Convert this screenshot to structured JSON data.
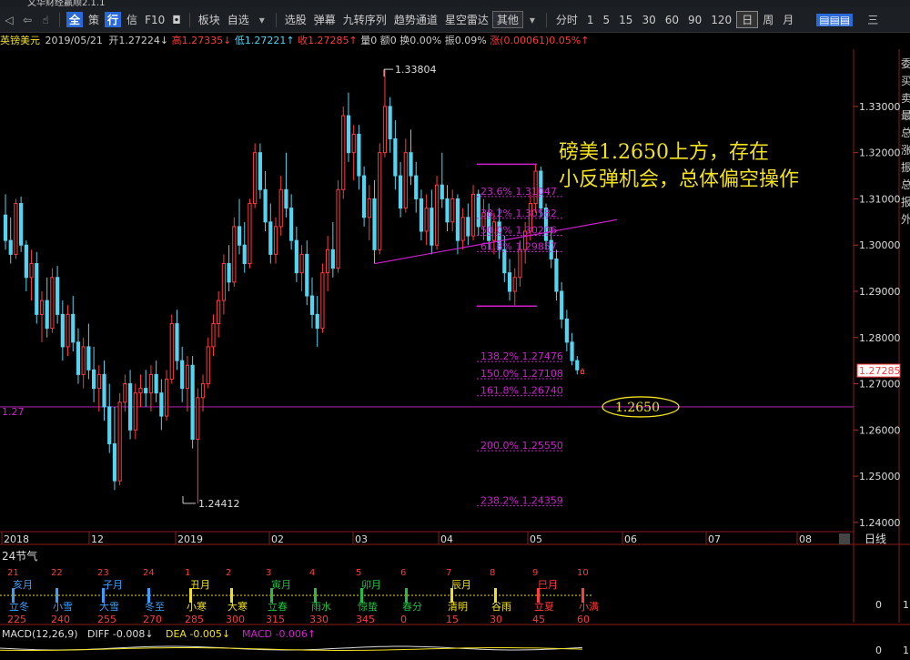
{
  "app": {
    "title": "文华财经赢顺2.1.1"
  },
  "toolbar": {
    "nav_icons": [
      "◁",
      "⇦",
      "☝"
    ],
    "items": [
      "全",
      "策",
      "行",
      "信",
      "F10",
      "◘",
      "板块",
      "自选",
      "选股",
      "弹幕",
      "九转序列",
      "趋势通道",
      "星空雷达",
      "其他",
      "分时",
      "1",
      "5",
      "15",
      "30",
      "60",
      "90",
      "120",
      "日",
      "周",
      "月"
    ],
    "dropdown_arrow": "▾",
    "right_button": "▤▤▤",
    "right_text": "三"
  },
  "info": {
    "symbol": "英镑美元",
    "date": "2019/05/21",
    "open_label": "开",
    "open": "1.27224↓",
    "high_label": "高",
    "high": "1.27335↓",
    "low_label": "低",
    "low": "1.27221↑",
    "close_label": "收",
    "close": "1.27285↑",
    "vol_label": "量",
    "vol": "0",
    "amt_label": "额",
    "amt": "0",
    "turnover_label": "换",
    "turnover": "0.00%",
    "amp_label": "振",
    "amp": "0.09%",
    "chg_label": "涨",
    "chg": "(0.00061)0.05%↑"
  },
  "colors": {
    "up": "#ff3b3b",
    "down": "#54d4f0",
    "fib": "#d020d0",
    "hline": "#a020a0",
    "annot": "#f0e020",
    "bg": "#000000"
  },
  "chart_data": {
    "type": "candlestick",
    "title": "",
    "ylim": [
      1.238,
      1.342
    ],
    "y_ticks": [
      1.24,
      1.25,
      1.26,
      1.27,
      1.28,
      1.29,
      1.3,
      1.31,
      1.32,
      1.33
    ],
    "y_tick_labels": [
      "1.24000",
      "1.25000",
      "1.26000",
      "1.27000",
      "1.28000",
      "1.29000",
      "1.30000",
      "1.31000",
      "1.32000",
      "1.33000"
    ],
    "x_labels": [
      "2018",
      "12",
      "2019",
      "02",
      "03",
      "04",
      "05",
      "06",
      "07",
      "08"
    ],
    "current_price": "1.27285",
    "high_marker": "1.33804",
    "low_marker": "1.24412",
    "horizontal_line": {
      "value": 1.265,
      "label": "1.27"
    },
    "fib_levels": [
      {
        "ratio": "23.6%",
        "value": "1.31047",
        "price": 1.3105
      },
      {
        "ratio": "38.2%",
        "value": "1.30582",
        "price": 1.3058
      },
      {
        "ratio": "50.0%",
        "value": "1.30206",
        "price": 1.3021
      },
      {
        "ratio": "61.8%",
        "value": "1.29857",
        "price": 1.2986
      },
      {
        "ratio": "138.2%",
        "value": "1.27476",
        "price": 1.2748
      },
      {
        "ratio": "150.0%",
        "value": "1.27108",
        "price": 1.2711
      },
      {
        "ratio": "161.8%",
        "value": "1.26740",
        "price": 1.2674
      },
      {
        "ratio": "200.0%",
        "value": "1.25550",
        "price": 1.2555
      },
      {
        "ratio": "238.2%",
        "value": "1.24359",
        "price": 1.2436
      }
    ],
    "annotation": "磅美1.2650上方，存在小反弹机会，总体偏空操作",
    "target_label": "1.2650",
    "period_label": "日线",
    "candles": [
      [
        1.3065,
        1.311,
        1.299,
        1.301
      ],
      [
        1.301,
        1.306,
        1.296,
        1.298
      ],
      [
        1.298,
        1.31,
        1.297,
        1.309
      ],
      [
        1.309,
        1.3105,
        1.2985,
        1.3
      ],
      [
        1.3,
        1.301,
        1.29,
        1.293
      ],
      [
        1.293,
        1.299,
        1.288,
        1.296
      ],
      [
        1.296,
        1.2985,
        1.283,
        1.285
      ],
      [
        1.285,
        1.29,
        1.279,
        1.288
      ],
      [
        1.288,
        1.293,
        1.28,
        1.282
      ],
      [
        1.282,
        1.295,
        1.281,
        1.293
      ],
      [
        1.293,
        1.2955,
        1.283,
        1.285
      ],
      [
        1.285,
        1.288,
        1.275,
        1.278
      ],
      [
        1.278,
        1.287,
        1.276,
        1.285
      ],
      [
        1.285,
        1.289,
        1.277,
        1.279
      ],
      [
        1.279,
        1.282,
        1.27,
        1.272
      ],
      [
        1.272,
        1.28,
        1.269,
        1.278
      ],
      [
        1.278,
        1.283,
        1.271,
        1.273
      ],
      [
        1.273,
        1.278,
        1.266,
        1.269
      ],
      [
        1.269,
        1.274,
        1.264,
        1.272
      ],
      [
        1.272,
        1.275,
        1.262,
        1.265
      ],
      [
        1.265,
        1.27,
        1.255,
        1.257
      ],
      [
        1.257,
        1.265,
        1.247,
        1.249
      ],
      [
        1.249,
        1.268,
        1.248,
        1.266
      ],
      [
        1.266,
        1.272,
        1.264,
        1.27
      ],
      [
        1.27,
        1.273,
        1.258,
        1.26
      ],
      [
        1.26,
        1.27,
        1.258,
        1.268
      ],
      [
        1.268,
        1.272,
        1.265,
        1.269
      ],
      [
        1.269,
        1.273,
        1.265,
        1.268
      ],
      [
        1.268,
        1.274,
        1.264,
        1.272
      ],
      [
        1.272,
        1.275,
        1.266,
        1.268
      ],
      [
        1.268,
        1.271,
        1.26,
        1.263
      ],
      [
        1.263,
        1.273,
        1.262,
        1.271
      ],
      [
        1.271,
        1.285,
        1.27,
        1.283
      ],
      [
        1.283,
        1.286,
        1.273,
        1.275
      ],
      [
        1.275,
        1.278,
        1.266,
        1.269
      ],
      [
        1.269,
        1.276,
        1.264,
        1.274
      ],
      [
        1.274,
        1.276,
        1.256,
        1.258
      ],
      [
        1.258,
        1.269,
        1.2441,
        1.267
      ],
      [
        1.267,
        1.272,
        1.264,
        1.27
      ],
      [
        1.27,
        1.28,
        1.269,
        1.278
      ],
      [
        1.278,
        1.285,
        1.276,
        1.283
      ],
      [
        1.283,
        1.29,
        1.28,
        1.288
      ],
      [
        1.288,
        1.298,
        1.285,
        1.296
      ],
      [
        1.296,
        1.3,
        1.29,
        1.292
      ],
      [
        1.292,
        1.306,
        1.291,
        1.304
      ],
      [
        1.304,
        1.31,
        1.298,
        1.3
      ],
      [
        1.3,
        1.305,
        1.294,
        1.296
      ],
      [
        1.296,
        1.31,
        1.295,
        1.309
      ],
      [
        1.309,
        1.322,
        1.308,
        1.32
      ],
      [
        1.32,
        1.322,
        1.31,
        1.312
      ],
      [
        1.312,
        1.316,
        1.303,
        1.305
      ],
      [
        1.305,
        1.309,
        1.296,
        1.298
      ],
      [
        1.298,
        1.306,
        1.296,
        1.304
      ],
      [
        1.304,
        1.315,
        1.302,
        1.312
      ],
      [
        1.312,
        1.32,
        1.306,
        1.308
      ],
      [
        1.308,
        1.311,
        1.299,
        1.301
      ],
      [
        1.301,
        1.304,
        1.292,
        1.294
      ],
      [
        1.294,
        1.3,
        1.29,
        1.298
      ],
      [
        1.298,
        1.301,
        1.287,
        1.289
      ],
      [
        1.289,
        1.293,
        1.282,
        1.285
      ],
      [
        1.285,
        1.289,
        1.278,
        1.282
      ],
      [
        1.282,
        1.296,
        1.281,
        1.294
      ],
      [
        1.294,
        1.302,
        1.29,
        1.299
      ],
      [
        1.299,
        1.305,
        1.293,
        1.295
      ],
      [
        1.295,
        1.314,
        1.294,
        1.312
      ],
      [
        1.312,
        1.33,
        1.31,
        1.328
      ],
      [
        1.328,
        1.333,
        1.318,
        1.32
      ],
      [
        1.32,
        1.326,
        1.314,
        1.324
      ],
      [
        1.324,
        1.326,
        1.312,
        1.315
      ],
      [
        1.315,
        1.317,
        1.304,
        1.306
      ],
      [
        1.306,
        1.313,
        1.301,
        1.31
      ],
      [
        1.31,
        1.314,
        1.296,
        1.299
      ],
      [
        1.299,
        1.322,
        1.298,
        1.32
      ],
      [
        1.32,
        1.338,
        1.319,
        1.33
      ],
      [
        1.33,
        1.332,
        1.32,
        1.323
      ],
      [
        1.323,
        1.327,
        1.312,
        1.315
      ],
      [
        1.315,
        1.318,
        1.306,
        1.308
      ],
      [
        1.308,
        1.323,
        1.307,
        1.32
      ],
      [
        1.32,
        1.325,
        1.313,
        1.315
      ],
      [
        1.315,
        1.318,
        1.307,
        1.31
      ],
      [
        1.31,
        1.312,
        1.301,
        1.303
      ],
      [
        1.303,
        1.311,
        1.3,
        1.308
      ],
      [
        1.308,
        1.312,
        1.298,
        1.3
      ],
      [
        1.3,
        1.315,
        1.299,
        1.313
      ],
      [
        1.313,
        1.32,
        1.308,
        1.31
      ],
      [
        1.31,
        1.313,
        1.303,
        1.305
      ],
      [
        1.305,
        1.312,
        1.303,
        1.31
      ],
      [
        1.31,
        1.311,
        1.298,
        1.301
      ],
      [
        1.301,
        1.308,
        1.299,
        1.306
      ],
      [
        1.306,
        1.309,
        1.3,
        1.302
      ],
      [
        1.302,
        1.313,
        1.301,
        1.311
      ],
      [
        1.311,
        1.312,
        1.302,
        1.304
      ],
      [
        1.304,
        1.31,
        1.301,
        1.307
      ],
      [
        1.307,
        1.309,
        1.299,
        1.301
      ],
      [
        1.301,
        1.307,
        1.298,
        1.305
      ],
      [
        1.305,
        1.308,
        1.297,
        1.299
      ],
      [
        1.299,
        1.302,
        1.292,
        1.294
      ],
      [
        1.294,
        1.297,
        1.288,
        1.29
      ],
      [
        1.29,
        1.295,
        1.287,
        1.293
      ],
      [
        1.293,
        1.301,
        1.291,
        1.299
      ],
      [
        1.299,
        1.305,
        1.296,
        1.303
      ],
      [
        1.303,
        1.311,
        1.301,
        1.309
      ],
      [
        1.309,
        1.3175,
        1.307,
        1.316
      ],
      [
        1.316,
        1.317,
        1.306,
        1.308
      ],
      [
        1.308,
        1.309,
        1.299,
        1.301
      ],
      [
        1.301,
        1.304,
        1.295,
        1.297
      ],
      [
        1.297,
        1.299,
        1.288,
        1.29
      ],
      [
        1.29,
        1.292,
        1.282,
        1.284
      ],
      [
        1.284,
        1.286,
        1.277,
        1.279
      ],
      [
        1.279,
        1.281,
        1.274,
        1.275
      ],
      [
        1.275,
        1.276,
        1.272,
        1.273
      ],
      [
        1.2722,
        1.2734,
        1.2722,
        1.2729
      ]
    ]
  },
  "jieqi": {
    "title": "24节气",
    "branches": [
      {
        "text": "亥月",
        "color": "#3aa0ff"
      },
      {
        "text": "子月",
        "color": "#3aa0ff"
      },
      {
        "text": "丑月",
        "color": "#f0e020"
      },
      {
        "text": "寅月",
        "color": "#20c040"
      },
      {
        "text": "卯月",
        "color": "#20c040"
      },
      {
        "text": "辰月",
        "color": "#f0e020"
      },
      {
        "text": "巳月",
        "color": "#ff3b3b"
      }
    ],
    "top_numbers": [
      "21",
      "22",
      "23",
      "24",
      "1",
      "2",
      "3",
      "4",
      "5",
      "6",
      "7",
      "8",
      "9",
      "10"
    ],
    "terms": [
      {
        "name": "立冬",
        "deg": "225",
        "color": "#3aa0ff"
      },
      {
        "name": "小雪",
        "deg": "240",
        "color": "#3aa0ff"
      },
      {
        "name": "大雪",
        "deg": "255",
        "color": "#3aa0ff"
      },
      {
        "name": "冬至",
        "deg": "270",
        "color": "#3aa0ff"
      },
      {
        "name": "小寒",
        "deg": "285",
        "color": "#f0e020"
      },
      {
        "name": "大寒",
        "deg": "300",
        "color": "#f0e020"
      },
      {
        "name": "立春",
        "deg": "315",
        "color": "#20c040"
      },
      {
        "name": "雨水",
        "deg": "330",
        "color": "#20c040"
      },
      {
        "name": "惊蛰",
        "deg": "345",
        "color": "#20c040"
      },
      {
        "name": "春分",
        "deg": "0",
        "color": "#20c040"
      },
      {
        "name": "清明",
        "deg": "15",
        "color": "#f0e020"
      },
      {
        "name": "谷雨",
        "deg": "30",
        "color": "#f0e020"
      },
      {
        "name": "立夏",
        "deg": "45",
        "color": "#ff3b3b"
      },
      {
        "name": "小满",
        "deg": "60",
        "color": "#ff3b3b"
      }
    ],
    "right_value": "0",
    "right_value2": "1"
  },
  "macd": {
    "label": "MACD(12,26,9)",
    "diff_label": "DIFF",
    "diff": "-0.008↓",
    "dea_label": "DEA",
    "dea": "-0.005↓",
    "macd_label": "MACD",
    "macd": "-0.006↑",
    "right_value": "0",
    "right_value2": "1"
  },
  "right_panel": {
    "chars": [
      "委",
      "买",
      "卖",
      "最",
      "总",
      "涨",
      "振",
      "总",
      "报",
      "外"
    ],
    "values": [
      "1.32000",
      "1.31000",
      "1.30000",
      "1.29000"
    ]
  }
}
